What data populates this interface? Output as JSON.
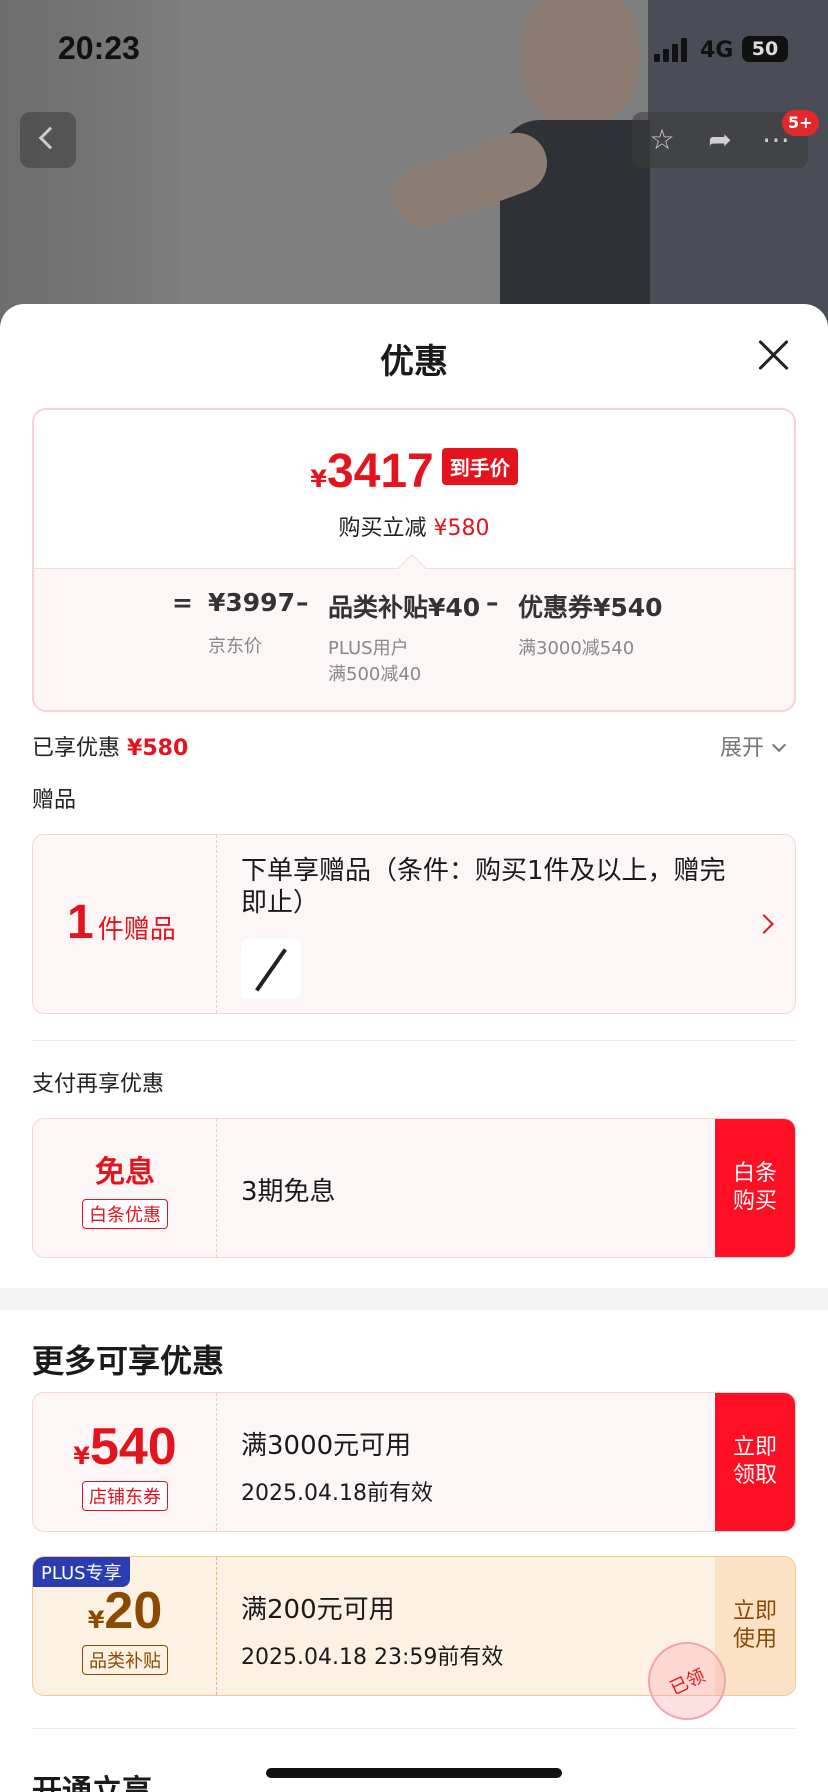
{
  "status_bar": {
    "time": "20:23",
    "network": "4G",
    "battery": "50"
  },
  "nav": {
    "badge": "5+"
  },
  "sheet": {
    "title": "优惠",
    "price": {
      "currency": "¥",
      "final_amount": "3417",
      "final_tag": "到手价",
      "reduction_label": "购买立减",
      "reduction_value": "¥580",
      "eq": "=",
      "minus": "–",
      "jd_price": "¥3997",
      "jd_price_label": "京东价",
      "subsidy": "品类补贴¥40",
      "subsidy_sub1": "PLUS用户",
      "subsidy_sub2": "满500减40",
      "coupon": "优惠券¥540",
      "coupon_sub": "满3000减540"
    },
    "enjoyed_label": "已享优惠",
    "enjoyed_value": "¥580",
    "expand_label": "展开",
    "gift_section": "赠品",
    "gift": {
      "count": "1",
      "unit": "件赠品",
      "desc": "下单享赠品（条件：购买1件及以上，赠完即止）"
    },
    "pay_section": "支付再享优惠",
    "baitiao": {
      "main": "免息",
      "pill": "白条优惠",
      "desc": "3期免息",
      "action_line1": "白条",
      "action_line2": "购买"
    },
    "more_title": "更多可享优惠",
    "coupons": [
      {
        "currency": "¥",
        "amount": "540",
        "pill": "店铺东券",
        "line1": "满3000元可用",
        "line2": "2025.04.18前有效",
        "action_line1": "立即",
        "action_line2": "领取"
      },
      {
        "tag": "PLUS专享",
        "currency": "¥",
        "amount": "20",
        "pill": "品类补贴",
        "line1": "满200元可用",
        "line2": "2025.04.18 23:59前有效",
        "action_line1": "立即",
        "action_line2": "使用",
        "stamp": "已领"
      }
    ],
    "open_title": "开通立享"
  },
  "colors": {
    "accent": "#e3141e",
    "plus_blue": "#2b3bb0",
    "gold": "#8a4b00"
  }
}
